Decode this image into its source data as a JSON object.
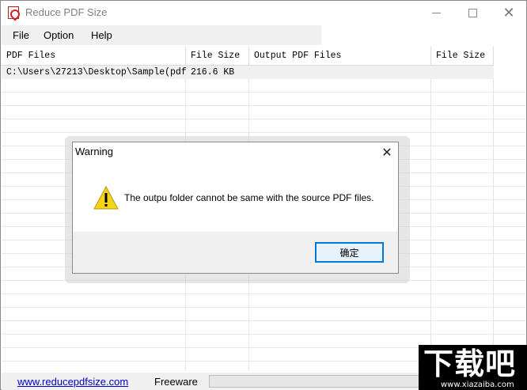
{
  "window": {
    "title": "Reduce PDF Size"
  },
  "menu": {
    "file": "File",
    "option": "Option",
    "help": "Help"
  },
  "table": {
    "columns": [
      "PDF Files",
      "File Size",
      "Output PDF Files",
      "File Size"
    ],
    "rows": [
      {
        "pdf_file": "C:\\Users\\27213\\Desktop\\Sample(pdf)...",
        "file_size": "216.6 KB",
        "output_file": "",
        "output_size": ""
      }
    ]
  },
  "status": {
    "link": "www.reducepdfsize.com",
    "license": "Freeware"
  },
  "dialog": {
    "title": "Warning",
    "message": "The outpu folder cannot be same with the source PDF files.",
    "ok_label": "确定",
    "icon": "warning-icon"
  },
  "watermark": {
    "big": "下载吧",
    "small": "www.xiazaiba.com"
  },
  "colors": {
    "link": "#0000cc",
    "button_border": "#0078d7",
    "button_fill": "#e5f1fb",
    "warning_yellow": "#f5d31a"
  }
}
